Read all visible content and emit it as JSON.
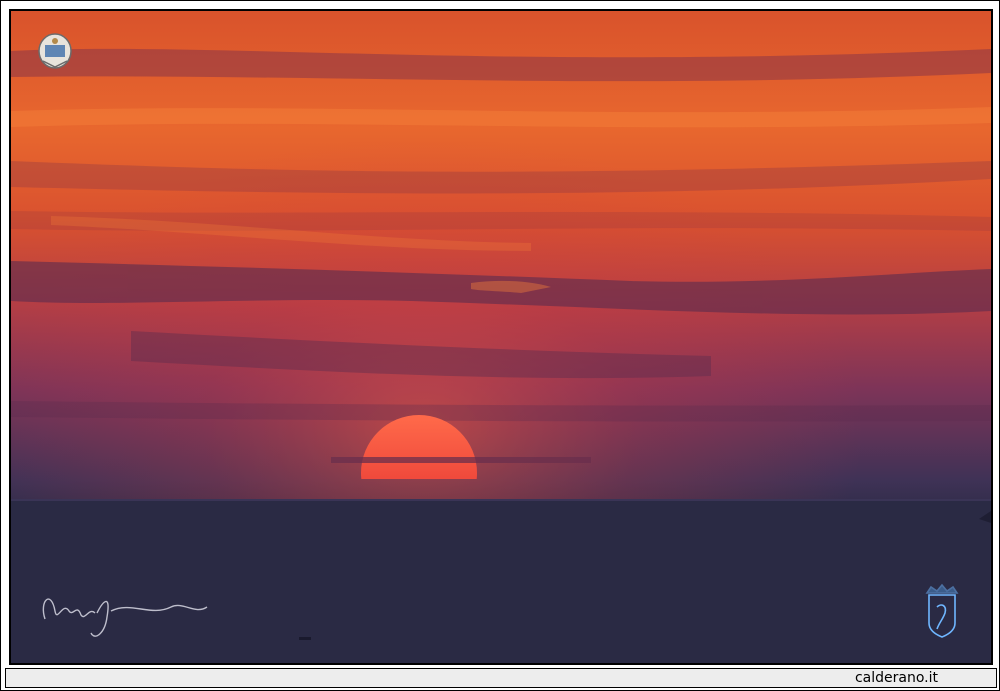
{
  "footer": {
    "site": "calderano.it"
  },
  "photo": {
    "subject": "sunset",
    "colors": {
      "sky_top": "#e4572a",
      "sky_mid": "#d8452c",
      "sky_low": "#8c3a58",
      "horizon": "#3e3156",
      "sea": "#2b2a45",
      "sun": "#ee3a32",
      "sun_glow": "#ff6a4a"
    }
  },
  "watermarks": {
    "crest_top_left": "crest-icon",
    "signature": "signature-icon",
    "crest_bottom_right": "crest-icon"
  }
}
